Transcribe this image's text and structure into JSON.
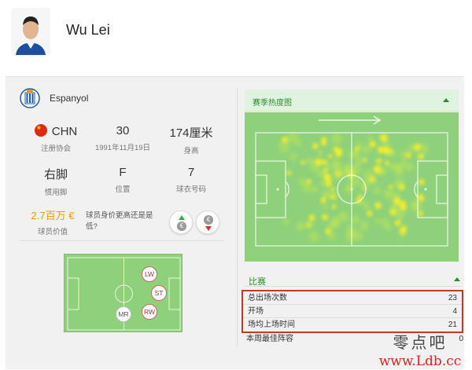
{
  "player": {
    "name": "Wu Lei"
  },
  "club": {
    "name": "Espanyol"
  },
  "stats_row1": [
    {
      "value": "CHN",
      "label": "注册协会"
    },
    {
      "value": "30",
      "label": "1991年11月19日"
    },
    {
      "value": "174厘米",
      "label": "身高"
    }
  ],
  "stats_row2": [
    {
      "value": "右脚",
      "label": "惯用脚"
    },
    {
      "value": "F",
      "label": "位置"
    },
    {
      "value": "7",
      "label": "球衣号码"
    }
  ],
  "market": {
    "value": "2.7百万 €",
    "label": "球员价值",
    "question": "球员身价更高还是是低?",
    "vote_up_symbol": "€",
    "vote_down_symbol": "€"
  },
  "positions": [
    "LW",
    "ST",
    "RW",
    "MR"
  ],
  "heatmap": {
    "title": "赛季热度图"
  },
  "matches": {
    "title": "比赛",
    "rows": [
      {
        "label": "总出场次数",
        "value": "23"
      },
      {
        "label": "开场",
        "value": "4"
      },
      {
        "label": "场均上场时间",
        "value": "21"
      }
    ],
    "extra": {
      "label": "本周最佳阵容",
      "value": "0"
    }
  },
  "watermark": {
    "cn": "零点吧",
    "url": "www.Ldb.cc"
  },
  "colors": {
    "pitch": "#8fd17a",
    "accent_green": "#2e8b2e",
    "market_value": "#e0a100",
    "highlight_border": "#c0392b",
    "heat_hot": "#f5ef2a"
  }
}
